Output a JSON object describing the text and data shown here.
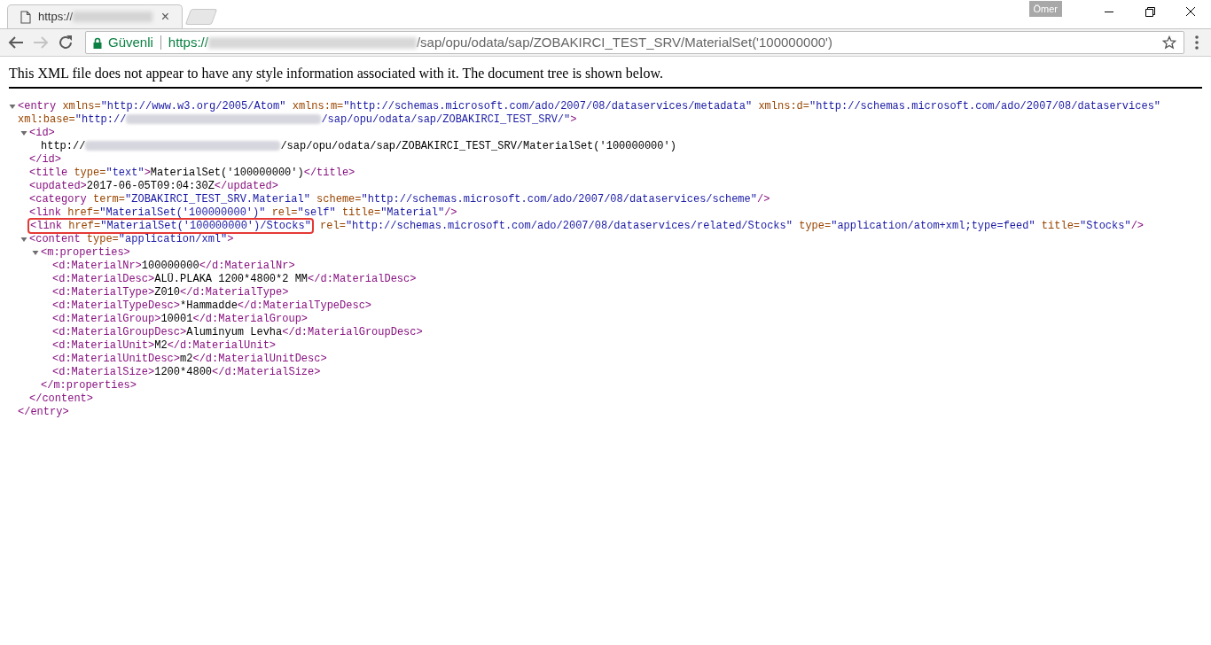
{
  "tab": {
    "title": "https://",
    "close": "×"
  },
  "profile": "Ömer",
  "omnibox": {
    "security": "Güvenli",
    "url_start": "https://",
    "url_end": "/sap/opu/odata/sap/ZOBAKIRCI_TEST_SRV/MaterialSet('100000000')"
  },
  "nav": {
    "forward_disabled": true
  },
  "notice": "This XML file does not appear to have any style information associated with it. The document tree is shown below.",
  "tree": {
    "expanded": true,
    "line": [
      {
        "kind": "tag",
        "text": "<entry"
      },
      {
        "kind": "attr",
        "name": "xmlns=",
        "value": "\"http://www.w3.org/2005/Atom\""
      },
      {
        "kind": "attr",
        "name": "xmlns:m=",
        "value": "\"http://schemas.microsoft.com/ado/2007/08/dataservices/metadata\""
      },
      {
        "kind": "attr",
        "name": "xmlns:d=",
        "value": "\"http://schemas.microsoft.com/ado/2007/08/dataservices\""
      },
      {
        "kind": "attr",
        "name": "xml:base=",
        "value": "\"http://"
      },
      {
        "kind": "blur"
      },
      {
        "kind": "value",
        "text": "/sap/opu/odata/sap/ZOBAKIRCI_TEST_SRV/\""
      },
      {
        "kind": "tag",
        "text": ">"
      }
    ],
    "children": [
      {
        "expanded": true,
        "line": [
          {
            "kind": "tag",
            "text": "<id>"
          }
        ],
        "children": [
          {
            "line": [
              {
                "kind": "text",
                "text": "http://"
              },
              {
                "kind": "blur"
              },
              {
                "kind": "text",
                "text": "/sap/opu/odata/sap/ZOBAKIRCI_TEST_SRV/MaterialSet('100000000')"
              }
            ]
          }
        ],
        "close": [
          {
            "kind": "tag",
            "text": "</id>"
          }
        ]
      },
      {
        "line": [
          {
            "kind": "tag",
            "text": "<title"
          },
          {
            "kind": "attr",
            "name": "type=",
            "value": "\"text\""
          },
          {
            "kind": "tag",
            "text": ">"
          },
          {
            "kind": "text",
            "text": "MaterialSet('100000000')"
          },
          {
            "kind": "tag",
            "text": "</title>"
          }
        ]
      },
      {
        "line": [
          {
            "kind": "tag",
            "text": "<updated>"
          },
          {
            "kind": "text",
            "text": "2017-06-05T09:04:30Z"
          },
          {
            "kind": "tag",
            "text": "</updated>"
          }
        ]
      },
      {
        "line": [
          {
            "kind": "tag",
            "text": "<category"
          },
          {
            "kind": "attr",
            "name": "term=",
            "value": "\"ZOBAKIRCI_TEST_SRV.Material\""
          },
          {
            "kind": "attr",
            "name": "scheme=",
            "value": "\"http://schemas.microsoft.com/ado/2007/08/dataservices/scheme\""
          },
          {
            "kind": "tag",
            "text": "/>"
          }
        ]
      },
      {
        "line": [
          {
            "kind": "tag",
            "text": "<link"
          },
          {
            "kind": "attr",
            "name": "href=",
            "value": "\"MaterialSet('100000000')\""
          },
          {
            "kind": "attr",
            "name": "rel=",
            "value": "\"self\""
          },
          {
            "kind": "attr",
            "name": "title=",
            "value": "\"Material\""
          },
          {
            "kind": "tag",
            "text": "/>"
          }
        ]
      },
      {
        "boxed": [
          {
            "kind": "tag",
            "text": "<link"
          },
          {
            "kind": "attr",
            "name": "href=",
            "value": "\"MaterialSet('100000000')/Stocks\""
          }
        ],
        "line": [
          {
            "kind": "attr",
            "name": "rel=",
            "value": "\"http://schemas.microsoft.com/ado/2007/08/dataservices/related/Stocks\""
          },
          {
            "kind": "attr",
            "name": "type=",
            "value": "\"application/atom+xml;type=feed\""
          },
          {
            "kind": "attr",
            "name": "title=",
            "value": "\"Stocks\""
          },
          {
            "kind": "tag",
            "text": "/>"
          }
        ]
      },
      {
        "expanded": true,
        "line": [
          {
            "kind": "tag",
            "text": "<content"
          },
          {
            "kind": "attr",
            "name": "type=",
            "value": "\"application/xml\""
          },
          {
            "kind": "tag",
            "text": ">"
          }
        ],
        "children": [
          {
            "expanded": true,
            "line": [
              {
                "kind": "tag",
                "text": "<m:properties>"
              }
            ],
            "children": [
              {
                "line": [
                  {
                    "kind": "tag",
                    "text": "<d:MaterialNr>"
                  },
                  {
                    "kind": "text",
                    "text": "100000000"
                  },
                  {
                    "kind": "tag",
                    "text": "</d:MaterialNr>"
                  }
                ]
              },
              {
                "line": [
                  {
                    "kind": "tag",
                    "text": "<d:MaterialDesc>"
                  },
                  {
                    "kind": "text",
                    "text": "ALÜ.PLAKA 1200*4800*2 MM"
                  },
                  {
                    "kind": "tag",
                    "text": "</d:MaterialDesc>"
                  }
                ]
              },
              {
                "line": [
                  {
                    "kind": "tag",
                    "text": "<d:MaterialType>"
                  },
                  {
                    "kind": "text",
                    "text": "Z010"
                  },
                  {
                    "kind": "tag",
                    "text": "</d:MaterialType>"
                  }
                ]
              },
              {
                "line": [
                  {
                    "kind": "tag",
                    "text": "<d:MaterialTypeDesc>"
                  },
                  {
                    "kind": "text",
                    "text": "*Hammadde"
                  },
                  {
                    "kind": "tag",
                    "text": "</d:MaterialTypeDesc>"
                  }
                ]
              },
              {
                "line": [
                  {
                    "kind": "tag",
                    "text": "<d:MaterialGroup>"
                  },
                  {
                    "kind": "text",
                    "text": "10001"
                  },
                  {
                    "kind": "tag",
                    "text": "</d:MaterialGroup>"
                  }
                ]
              },
              {
                "line": [
                  {
                    "kind": "tag",
                    "text": "<d:MaterialGroupDesc>"
                  },
                  {
                    "kind": "text",
                    "text": "Aluminyum Levha"
                  },
                  {
                    "kind": "tag",
                    "text": "</d:MaterialGroupDesc>"
                  }
                ]
              },
              {
                "line": [
                  {
                    "kind": "tag",
                    "text": "<d:MaterialUnit>"
                  },
                  {
                    "kind": "text",
                    "text": "M2"
                  },
                  {
                    "kind": "tag",
                    "text": "</d:MaterialUnit>"
                  }
                ]
              },
              {
                "line": [
                  {
                    "kind": "tag",
                    "text": "<d:MaterialUnitDesc>"
                  },
                  {
                    "kind": "text",
                    "text": "m2"
                  },
                  {
                    "kind": "tag",
                    "text": "</d:MaterialUnitDesc>"
                  }
                ]
              },
              {
                "line": [
                  {
                    "kind": "tag",
                    "text": "<d:MaterialSize>"
                  },
                  {
                    "kind": "text",
                    "text": "1200*4800"
                  },
                  {
                    "kind": "tag",
                    "text": "</d:MaterialSize>"
                  }
                ]
              }
            ],
            "close": [
              {
                "kind": "tag",
                "text": "</m:properties>"
              }
            ]
          }
        ],
        "close": [
          {
            "kind": "tag",
            "text": "</content>"
          }
        ]
      }
    ],
    "close": [
      {
        "kind": "tag",
        "text": "</entry>"
      }
    ]
  }
}
